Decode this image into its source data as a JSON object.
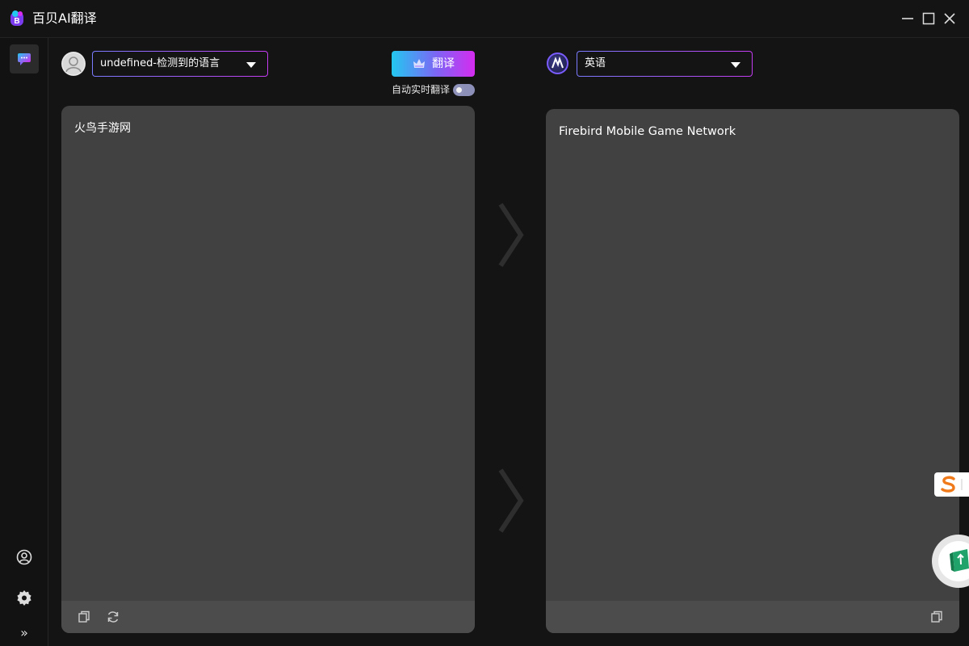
{
  "app": {
    "title": "百贝AI翻译"
  },
  "source": {
    "language": "undefined-检测到的语言",
    "text": "火鸟手游网"
  },
  "target": {
    "language": "英语",
    "text": "Firebird Mobile Game Network"
  },
  "toolbar": {
    "translate_label": "翻译",
    "auto_translate_label": "自动实时翻译",
    "auto_translate_on": false
  },
  "sidebar": {
    "expand_glyph": "»"
  },
  "colors": {
    "background": "#141414",
    "panel": "#414141",
    "panel_footer": "#4c4c4c",
    "accent_start": "#23c8f0",
    "accent_end": "#d52cf0"
  }
}
